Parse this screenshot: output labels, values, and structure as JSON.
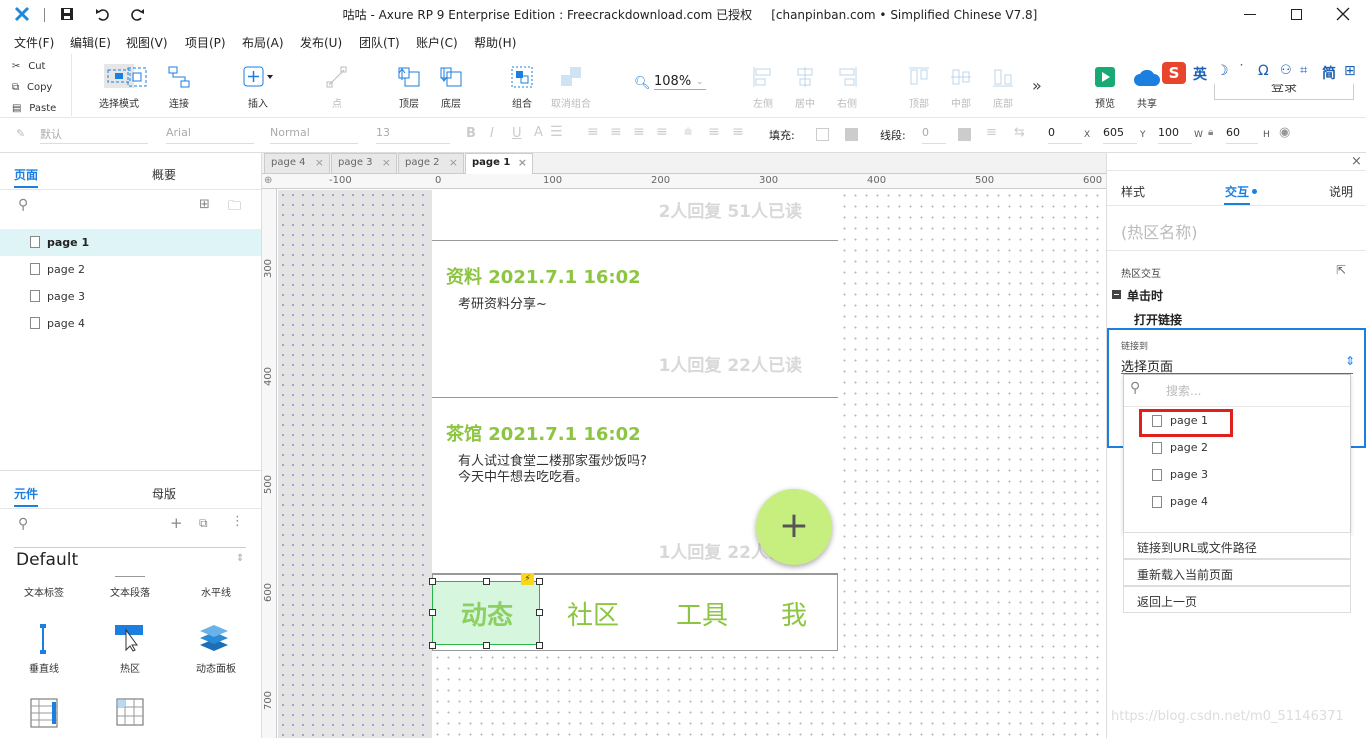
{
  "window": {
    "title": "咕咕 - Axure RP 9 Enterprise Edition : Freecrackdownload.com 已授权     [chanpinban.com • Simplified Chinese V7.8]"
  },
  "menu": [
    "文件(F)",
    "编辑(E)",
    "视图(V)",
    "项目(P)",
    "布局(A)",
    "发布(U)",
    "团队(T)",
    "账户(C)",
    "帮助(H)"
  ],
  "clipboard": {
    "cut": "Cut",
    "copy": "Copy",
    "paste": "Paste"
  },
  "toolbar": {
    "select_mode": "选择模式",
    "connect": "连接",
    "insert": "插入",
    "point": "点",
    "to_top": "顶层",
    "to_bottom": "底层",
    "group": "组合",
    "ungroup": "取消组合",
    "zoom": "108%",
    "align_left": "左侧",
    "align_center": "居中",
    "align_right": "右侧",
    "align_top": "顶部",
    "align_middle": "中部",
    "align_bottom": "底部",
    "preview": "预览",
    "share": "共享",
    "login": "登录",
    "ime_text": "英"
  },
  "format": {
    "style": "默认",
    "font": "Arial",
    "weight": "Normal",
    "size": "13",
    "fill_label": "填充:",
    "stroke_label": "线段:",
    "stroke_value": "0",
    "x_value": "0",
    "x_label": "X",
    "y_value": "605",
    "y_label": "Y",
    "w_value": "100",
    "w_label": "W",
    "h_value": "60",
    "h_label": "H"
  },
  "left": {
    "tab_pages": "页面",
    "tab_outline": "概要",
    "pages": [
      "page 1",
      "page 2",
      "page 3",
      "page 4"
    ],
    "tab_widgets": "元件",
    "tab_masters": "母版",
    "library": "Default",
    "widgets": [
      "文本标签",
      "文本段落",
      "水平线",
      "垂直线",
      "热区",
      "动态面板"
    ]
  },
  "doc_tabs": [
    "page 4",
    "page 3",
    "page 2",
    "page 1"
  ],
  "ruler": {
    "h": [
      "-100",
      "0",
      "100",
      "200",
      "300",
      "400",
      "500",
      "600"
    ],
    "v": [
      "300",
      "400",
      "500",
      "600",
      "700"
    ]
  },
  "posts": [
    {
      "stats": "2人回复 51人已读"
    },
    {
      "title": "资料 2021.7.1 16:02",
      "body": [
        "考研资料分享~"
      ],
      "stats": "1人回复 22人已读"
    },
    {
      "title": "茶馆 2021.7.1 16:02",
      "body": [
        "有人试过食堂二楼那家蛋炒饭吗?",
        "今天中午想去吃吃看。"
      ],
      "stats": "1人回复 22人已读"
    }
  ],
  "fab": "+",
  "tabbar": [
    "动态",
    "社区",
    "工具",
    "我"
  ],
  "right": {
    "tab_style": "样式",
    "tab_interaction": "交互",
    "tab_notes": "说明",
    "hotspot_name": "(热区名称)",
    "section": "热区交互",
    "event": "单击时",
    "action": "打开链接",
    "link_label": "链接到",
    "select_value": "选择页面",
    "search_placeholder": "搜索...",
    "pages": [
      "page 1",
      "page 2",
      "page 3",
      "page 4"
    ],
    "actions": [
      "链接到URL或文件路径",
      "重新载入当前页面",
      "返回上一页"
    ]
  },
  "watermark": "https://blog.csdn.net/m0_51146371",
  "colors": {
    "accent_blue": "#1a7fe0",
    "brand_green": "#8cc541",
    "highlight_red": "#e01f1f",
    "fab_green": "#c6ef80"
  }
}
